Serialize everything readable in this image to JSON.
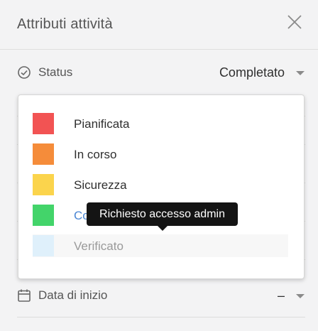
{
  "header": {
    "title": "Attributi attività",
    "close_icon": "close-icon"
  },
  "status_row": {
    "label": "Status",
    "value": "Completato",
    "icon": "check-circle-icon"
  },
  "date_row": {
    "label": "Data di inizio",
    "value": "–",
    "icon": "calendar-icon"
  },
  "dropdown": {
    "options": [
      {
        "label": "Pianificata",
        "color": "#f25353"
      },
      {
        "label": "In corso",
        "color": "#f58c3a"
      },
      {
        "label": "Sicurezza",
        "color": "#fbd44c"
      },
      {
        "label": "Co",
        "color": "#43d46a"
      },
      {
        "label": "Verificato",
        "color": "#dff0fb"
      }
    ]
  },
  "tooltip": {
    "text": "Richiesto accesso admin"
  }
}
